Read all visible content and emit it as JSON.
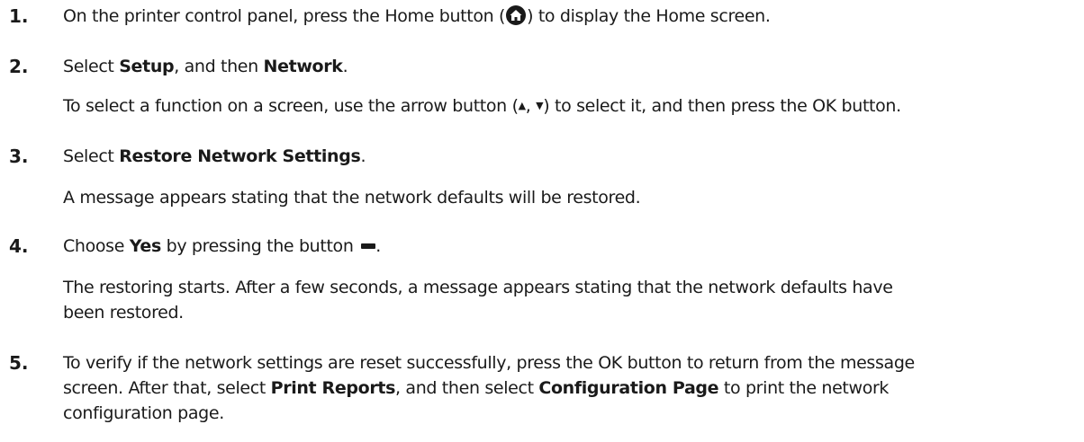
{
  "steps": [
    {
      "num": "1.",
      "pre": "On the printer control panel, press the Home button (",
      "icon": "home-icon",
      "post": ") to display the Home screen."
    },
    {
      "num": "2.",
      "pre": "Select ",
      "b1": "Setup",
      "mid": ", and then ",
      "b2": "Network",
      "post": ".",
      "sub": {
        "pre": "To select a function on a screen, use the arrow button (",
        "up": "▲",
        "sep": ", ",
        "down": "▼",
        "post": ") to select it, and then press the OK button."
      }
    },
    {
      "num": "3.",
      "pre": "Select ",
      "b1": "Restore Network Settings",
      "post": ".",
      "sub": "A message appears stating that the network defaults will be restored."
    },
    {
      "num": "4.",
      "pre": "Choose ",
      "b1": "Yes",
      "mid": " by pressing the button ",
      "icon": "dash-button-icon",
      "post": ".",
      "sub_line1": "The restoring starts. After a few seconds, a message appears stating that the network defaults have",
      "sub_line2": "been restored."
    },
    {
      "num": "5.",
      "line1": "To verify if the network settings are reset successfully, press the OK button to return from the message",
      "l2_pre": "screen. After that, select ",
      "l2_b1": "Print Reports",
      "l2_mid": ", and then select ",
      "l2_b2": "Configuration Page",
      "l2_post": " to print the network",
      "line3": "configuration page."
    }
  ]
}
